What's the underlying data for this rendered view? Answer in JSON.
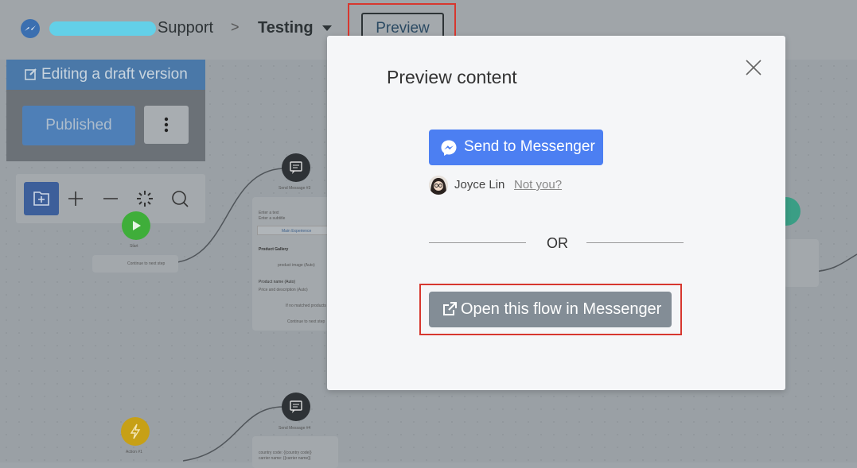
{
  "header": {
    "brand_suffix": "Support",
    "flow_name": "Testing",
    "preview_label": "Preview"
  },
  "sidebar": {
    "editing_label": "Editing a draft version",
    "published_label": "Published"
  },
  "canvas": {
    "node_send1_title": "Send Message #3",
    "node_send1_lines": [
      "Enter a text",
      "Enter a subtitle"
    ],
    "node_send1_button": "Main Experience",
    "product_gallery": "Product Gallery",
    "product_image": "product image (Auto)",
    "product_name": "Product name (Auto)",
    "price_desc": "Price and description (Auto)",
    "if_not_matched": "If no matched products",
    "continue_step": "Continue to next step",
    "start_label": "Start",
    "start_continue": "Continue to next step",
    "node_send2_title": "Send Message #4",
    "country_code": "country code: {{country code}}",
    "carrier_name": "carrier name: {{carrier name}}",
    "action_label": "Action #1"
  },
  "modal": {
    "title": "Preview content",
    "send_button": "Send to Messenger",
    "user_name": "Joyce Lin",
    "not_you": "Not you?",
    "or_label": "OR",
    "open_button": "Open this flow in Messenger"
  },
  "colors": {
    "send_button_bg": "#4c7ff2",
    "open_button_bg": "#838d96",
    "highlight_red": "#d7372f"
  }
}
